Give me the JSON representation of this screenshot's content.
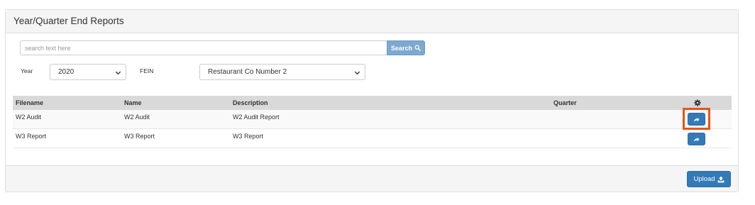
{
  "panel": {
    "title": "Year/Quarter End Reports"
  },
  "search": {
    "placeholder": "search text here",
    "value": "",
    "button_label": "Search",
    "button_icon": "search-icon"
  },
  "filters": {
    "year_label": "Year",
    "year_value": "2020",
    "fein_label": "FEIN",
    "fein_value": "Restaurant Co Number 2"
  },
  "table": {
    "columns": [
      "Filename",
      "Name",
      "Description",
      "Quarter"
    ],
    "settings_icon": "gear-icon",
    "rows": [
      {
        "filename": "W2 Audit",
        "name": "W2 Audit",
        "description": "W2 Audit Report",
        "quarter": "",
        "action_icon": "share-icon"
      },
      {
        "filename": "W3 Report",
        "name": "W3 Report",
        "description": "W3 Report",
        "quarter": "",
        "action_icon": "share-icon"
      }
    ]
  },
  "footer": {
    "upload_label": "Upload",
    "upload_icon": "upload-icon"
  },
  "colors": {
    "primary": "#337ab7",
    "search_button": "#7da9d0",
    "highlight": "#e8541a",
    "header_bg": "#f5f5f5",
    "table_header_bg": "#d9d9d9"
  }
}
